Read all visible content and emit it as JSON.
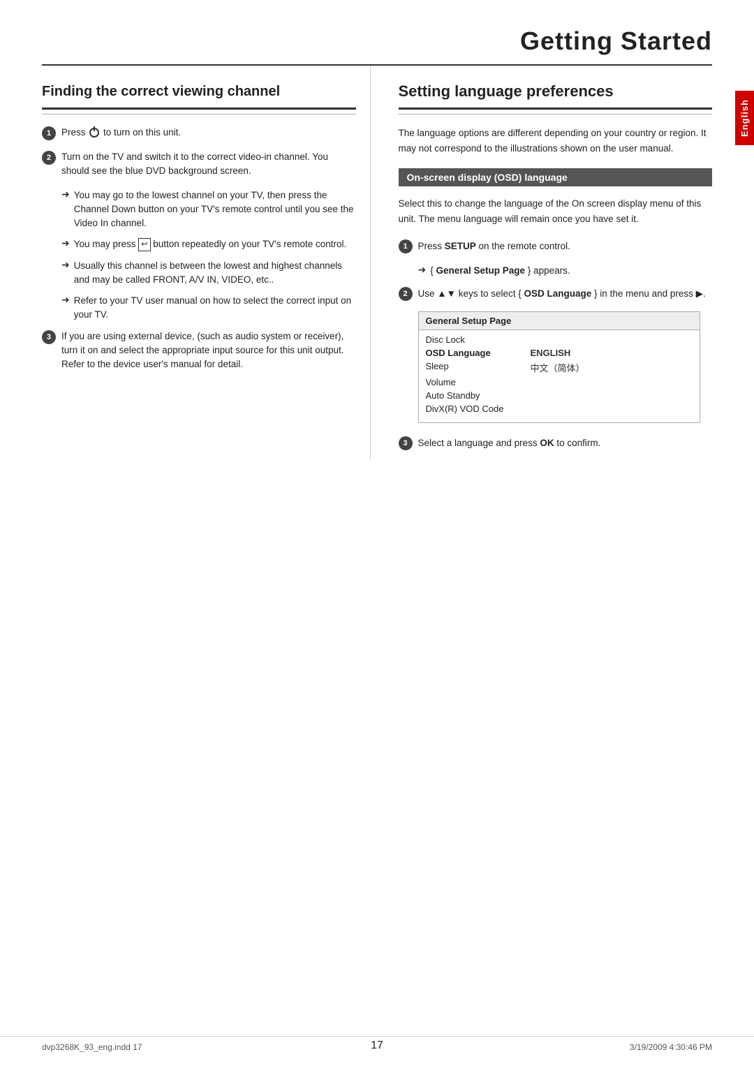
{
  "page": {
    "title": "Getting Started",
    "footer_left": "dvp3268K_93_eng.indd   17",
    "footer_right": "3/19/2009   4:30:46 PM",
    "page_number": "17"
  },
  "english_tab": "English",
  "left_section": {
    "title": "Finding the correct viewing channel",
    "steps": [
      {
        "number": "1",
        "text": "Press  to turn on this unit."
      },
      {
        "number": "2",
        "text": "Turn on the TV and switch it to the correct video-in channel. You should see the blue DVD background screen.",
        "arrows": [
          "You may go to the lowest channel on your TV, then press the Channel Down button on your TV's remote control until you see the Video In channel.",
          "You may press  button repeatedly on your TV's remote control.",
          "Usually this channel is between the lowest and highest channels and may be called FRONT, A/V IN, VIDEO, etc..",
          "Refer to your TV user manual on how to select the correct input on your TV."
        ]
      },
      {
        "number": "3",
        "text": "If you are using external device, (such as audio system or receiver), turn it on and select the appropriate input source for this unit output. Refer to the device user's manual for detail."
      }
    ]
  },
  "right_section": {
    "title": "Setting language preferences",
    "intro": "The language options are different depending on your country or region. It may not correspond to the illustrations shown on the user manual.",
    "osd_header": "On-screen display (OSD) language",
    "osd_description": "Select this to change the language of the On screen display menu of this unit. The menu language will remain once you have set it.",
    "steps": [
      {
        "number": "1",
        "text_before": "Press ",
        "bold_text": "SETUP",
        "text_after": " on the remote control.",
        "sub_arrow": "{ General Setup Page } appears."
      },
      {
        "number": "2",
        "text_before": "Use ▲▼ keys to select { ",
        "bold_text": "OSD Language",
        "text_after": " } in the menu and press ▶."
      },
      {
        "number": "3",
        "text_before": "Select a language and press ",
        "bold_text": "OK",
        "text_after": " to confirm."
      }
    ],
    "setup_table": {
      "header": "General Setup Page",
      "rows": [
        {
          "label": "Disc Lock",
          "value": "",
          "highlighted": false
        },
        {
          "label": "OSD Language",
          "value": "ENGLISH",
          "highlighted": true
        },
        {
          "label": "Sleep",
          "value": "中文（简体）",
          "highlighted": false
        },
        {
          "label": "Volume",
          "value": "",
          "highlighted": false
        },
        {
          "label": "Auto Standby",
          "value": "",
          "highlighted": false
        },
        {
          "label": "DivX(R) VOD Code",
          "value": "",
          "highlighted": false
        }
      ]
    }
  }
}
